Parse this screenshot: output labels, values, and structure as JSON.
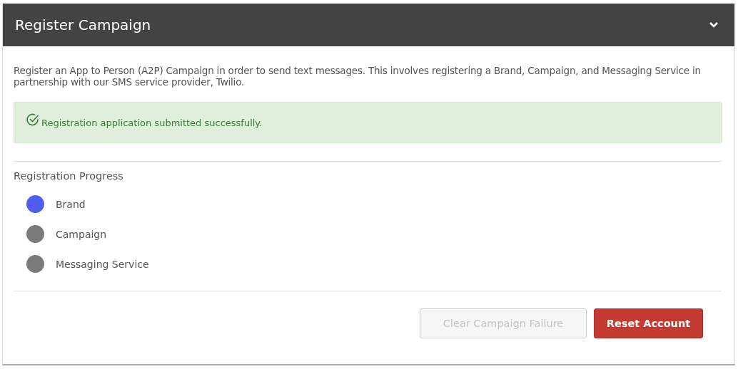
{
  "panel": {
    "title": "Register Campaign",
    "expanded": true
  },
  "description": "Register an App to Person (A2P) Campaign in order to send text messages. This involves registering a Brand, Campaign, and Messaging Service in partnership with our SMS service provider, Twilio.",
  "alert": {
    "kind": "success",
    "message": "Registration application submitted successfully."
  },
  "progress": {
    "title": "Registration Progress",
    "steps": [
      {
        "label": "Brand",
        "color": "#4f5ef0"
      },
      {
        "label": "Campaign",
        "color": "#7a7a7a"
      },
      {
        "label": "Messaging Service",
        "color": "#7a7a7a"
      }
    ]
  },
  "buttons": [
    {
      "label": "Clear Campaign Failure",
      "kind": "secondary",
      "disabled": true
    },
    {
      "label": "Reset Account",
      "kind": "danger",
      "disabled": false
    }
  ]
}
